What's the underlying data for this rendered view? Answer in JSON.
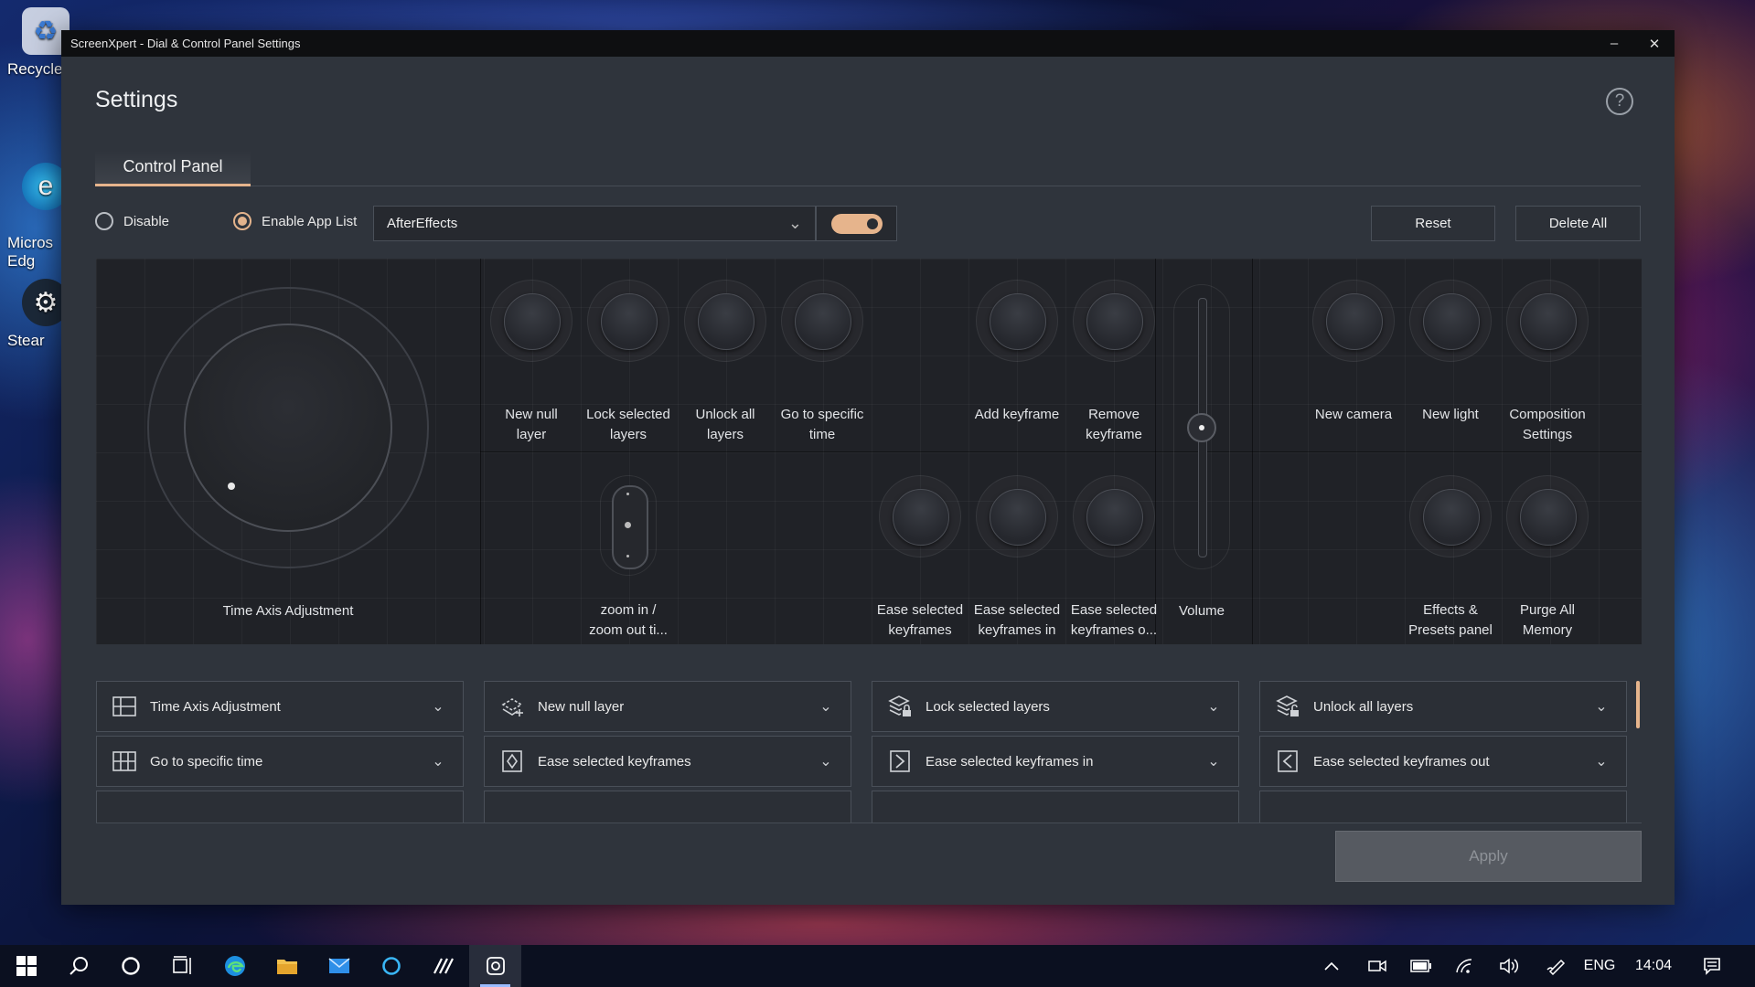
{
  "desktop": {
    "icons": [
      {
        "label": "Recycle",
        "icon": "recycle-bin-icon"
      },
      {
        "label": "Micros\nEdg",
        "icon": "edge-icon"
      },
      {
        "label": "Stear",
        "icon": "steam-icon"
      }
    ]
  },
  "window": {
    "title": "ScreenXpert - Dial & Control Panel Settings",
    "minimize": "–",
    "close": "✕"
  },
  "page": {
    "title": "Settings",
    "help": "?",
    "tabs": [
      {
        "label": "Control Panel",
        "active": true
      }
    ]
  },
  "toolbar": {
    "disable_label": "Disable",
    "enable_label": "Enable App List",
    "selected_mode": "enable",
    "app_select_value": "AfterEffects",
    "app_toggle_on": true,
    "reset_label": "Reset",
    "delete_all_label": "Delete All"
  },
  "panel": {
    "dial_label": "Time Axis Adjustment",
    "zoom_label": "zoom in /\nzoom out ti...",
    "volume_label": "Volume",
    "buttons_top": [
      "New null\nlayer",
      "Lock selected\nlayers",
      "Unlock all\nlayers",
      "Go to specific\ntime",
      "Add keyframe",
      "Remove\nkeyframe",
      "New camera",
      "New light",
      "Composition\nSettings"
    ],
    "buttons_bottom": [
      "Ease selected\nkeyframes",
      "Ease selected\nkeyframes in",
      "Ease selected\nkeyframes o...",
      "Effects &\nPresets panel",
      "Purge All\nMemory"
    ]
  },
  "assignments": [
    {
      "label": "Time Axis Adjustment",
      "icon": "timeline-icon"
    },
    {
      "label": "New null layer",
      "icon": "null-layer-icon"
    },
    {
      "label": "Lock selected layers",
      "icon": "lock-layers-icon"
    },
    {
      "label": "Unlock all layers",
      "icon": "unlock-layers-icon"
    },
    {
      "label": "Go to specific time",
      "icon": "go-to-time-icon"
    },
    {
      "label": "Ease selected keyframes",
      "icon": "ease-keyframes-icon"
    },
    {
      "label": "Ease selected keyframes in",
      "icon": "ease-in-icon"
    },
    {
      "label": "Ease selected keyframes out",
      "icon": "ease-out-icon"
    }
  ],
  "apply_label": "Apply",
  "taskbar": {
    "language": "ENG",
    "time": "14:04"
  },
  "colors": {
    "accent": "#e6b48c",
    "window_bg": "#2f343c",
    "panel_bg": "#202227",
    "titlebar": "#0e0f11"
  }
}
